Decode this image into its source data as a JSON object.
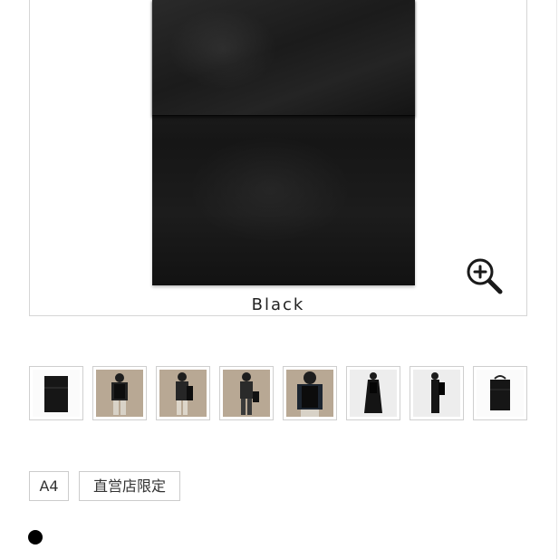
{
  "product": {
    "color_label": "Black"
  },
  "gallery": {
    "zoom_icon": "zoom-in-icon",
    "thumbnails": [
      {
        "icon": "bag-front-thumbnail"
      },
      {
        "icon": "model-back-view-thumbnail"
      },
      {
        "icon": "model-side-view-thumbnail"
      },
      {
        "icon": "model-front-view-thumbnail"
      },
      {
        "icon": "model-back-closeup-thumbnail"
      },
      {
        "icon": "model-full-length-thumbnail"
      },
      {
        "icon": "model-profile-thumbnail"
      },
      {
        "icon": "bag-backpack-thumbnail"
      }
    ]
  },
  "tags": [
    {
      "label": "A4"
    },
    {
      "label": "直営店限定"
    }
  ],
  "color_swatch": {
    "color": "#000000",
    "icon": "color-dot-icon"
  }
}
